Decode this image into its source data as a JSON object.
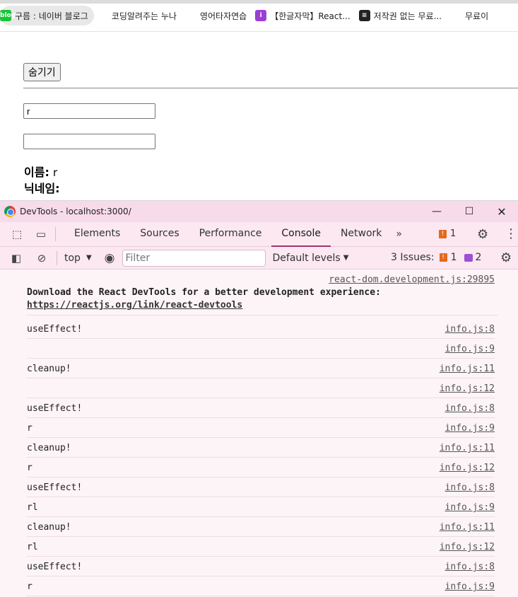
{
  "bookmarks": [
    {
      "label": "구름 : 네이버 블로그",
      "icon": "blog-icon"
    },
    {
      "label": "코딩알려주는 누나",
      "icon": "code-icon"
    },
    {
      "label": "영어타자연습",
      "icon": "fire-icon"
    },
    {
      "label": "【한글자막】React...",
      "icon": "info-icon"
    },
    {
      "label": "저작권 없는 무료...",
      "icon": "document-icon"
    },
    {
      "label": "무료이",
      "icon": "v-logo-icon"
    }
  ],
  "page": {
    "hide_button": "숨기기",
    "input1_value": "r",
    "input2_value": "",
    "name_label": "이름:",
    "name_value": "r",
    "nickname_label": "닉네임:",
    "nickname_value": ""
  },
  "devtools": {
    "title": "DevTools - localhost:3000/",
    "tabs": [
      "Elements",
      "Sources",
      "Performance",
      "Console",
      "Network"
    ],
    "active_tab": "Console",
    "more_tabs": "»",
    "tab_issue_count": "1",
    "context": "top",
    "filter_placeholder": "Filter",
    "levels": "Default levels",
    "issues_label": "3 Issues:",
    "issues_warn": "1",
    "issues_msg": "2",
    "react_msg": {
      "source": "react-dom.development.js:29895",
      "text": "Download the React DevTools for a better development experience:",
      "link": "https://reactjs.org/link/react-devtools"
    },
    "logs": [
      {
        "text": "useEffect!",
        "source": "info.js:8"
      },
      {
        "text": "",
        "source": "info.js:9"
      },
      {
        "text": "cleanup!",
        "source": "info.js:11"
      },
      {
        "text": "",
        "source": "info.js:12"
      },
      {
        "text": "useEffect!",
        "source": "info.js:8"
      },
      {
        "text": "r",
        "source": "info.js:9"
      },
      {
        "text": "cleanup!",
        "source": "info.js:11"
      },
      {
        "text": "r",
        "source": "info.js:12"
      },
      {
        "text": "useEffect!",
        "source": "info.js:8"
      },
      {
        "text": "rl",
        "source": "info.js:9"
      },
      {
        "text": "cleanup!",
        "source": "info.js:11"
      },
      {
        "text": "rl",
        "source": "info.js:12"
      },
      {
        "text": "useEffect!",
        "source": "info.js:8"
      },
      {
        "text": "r",
        "source": "info.js:9"
      }
    ]
  }
}
